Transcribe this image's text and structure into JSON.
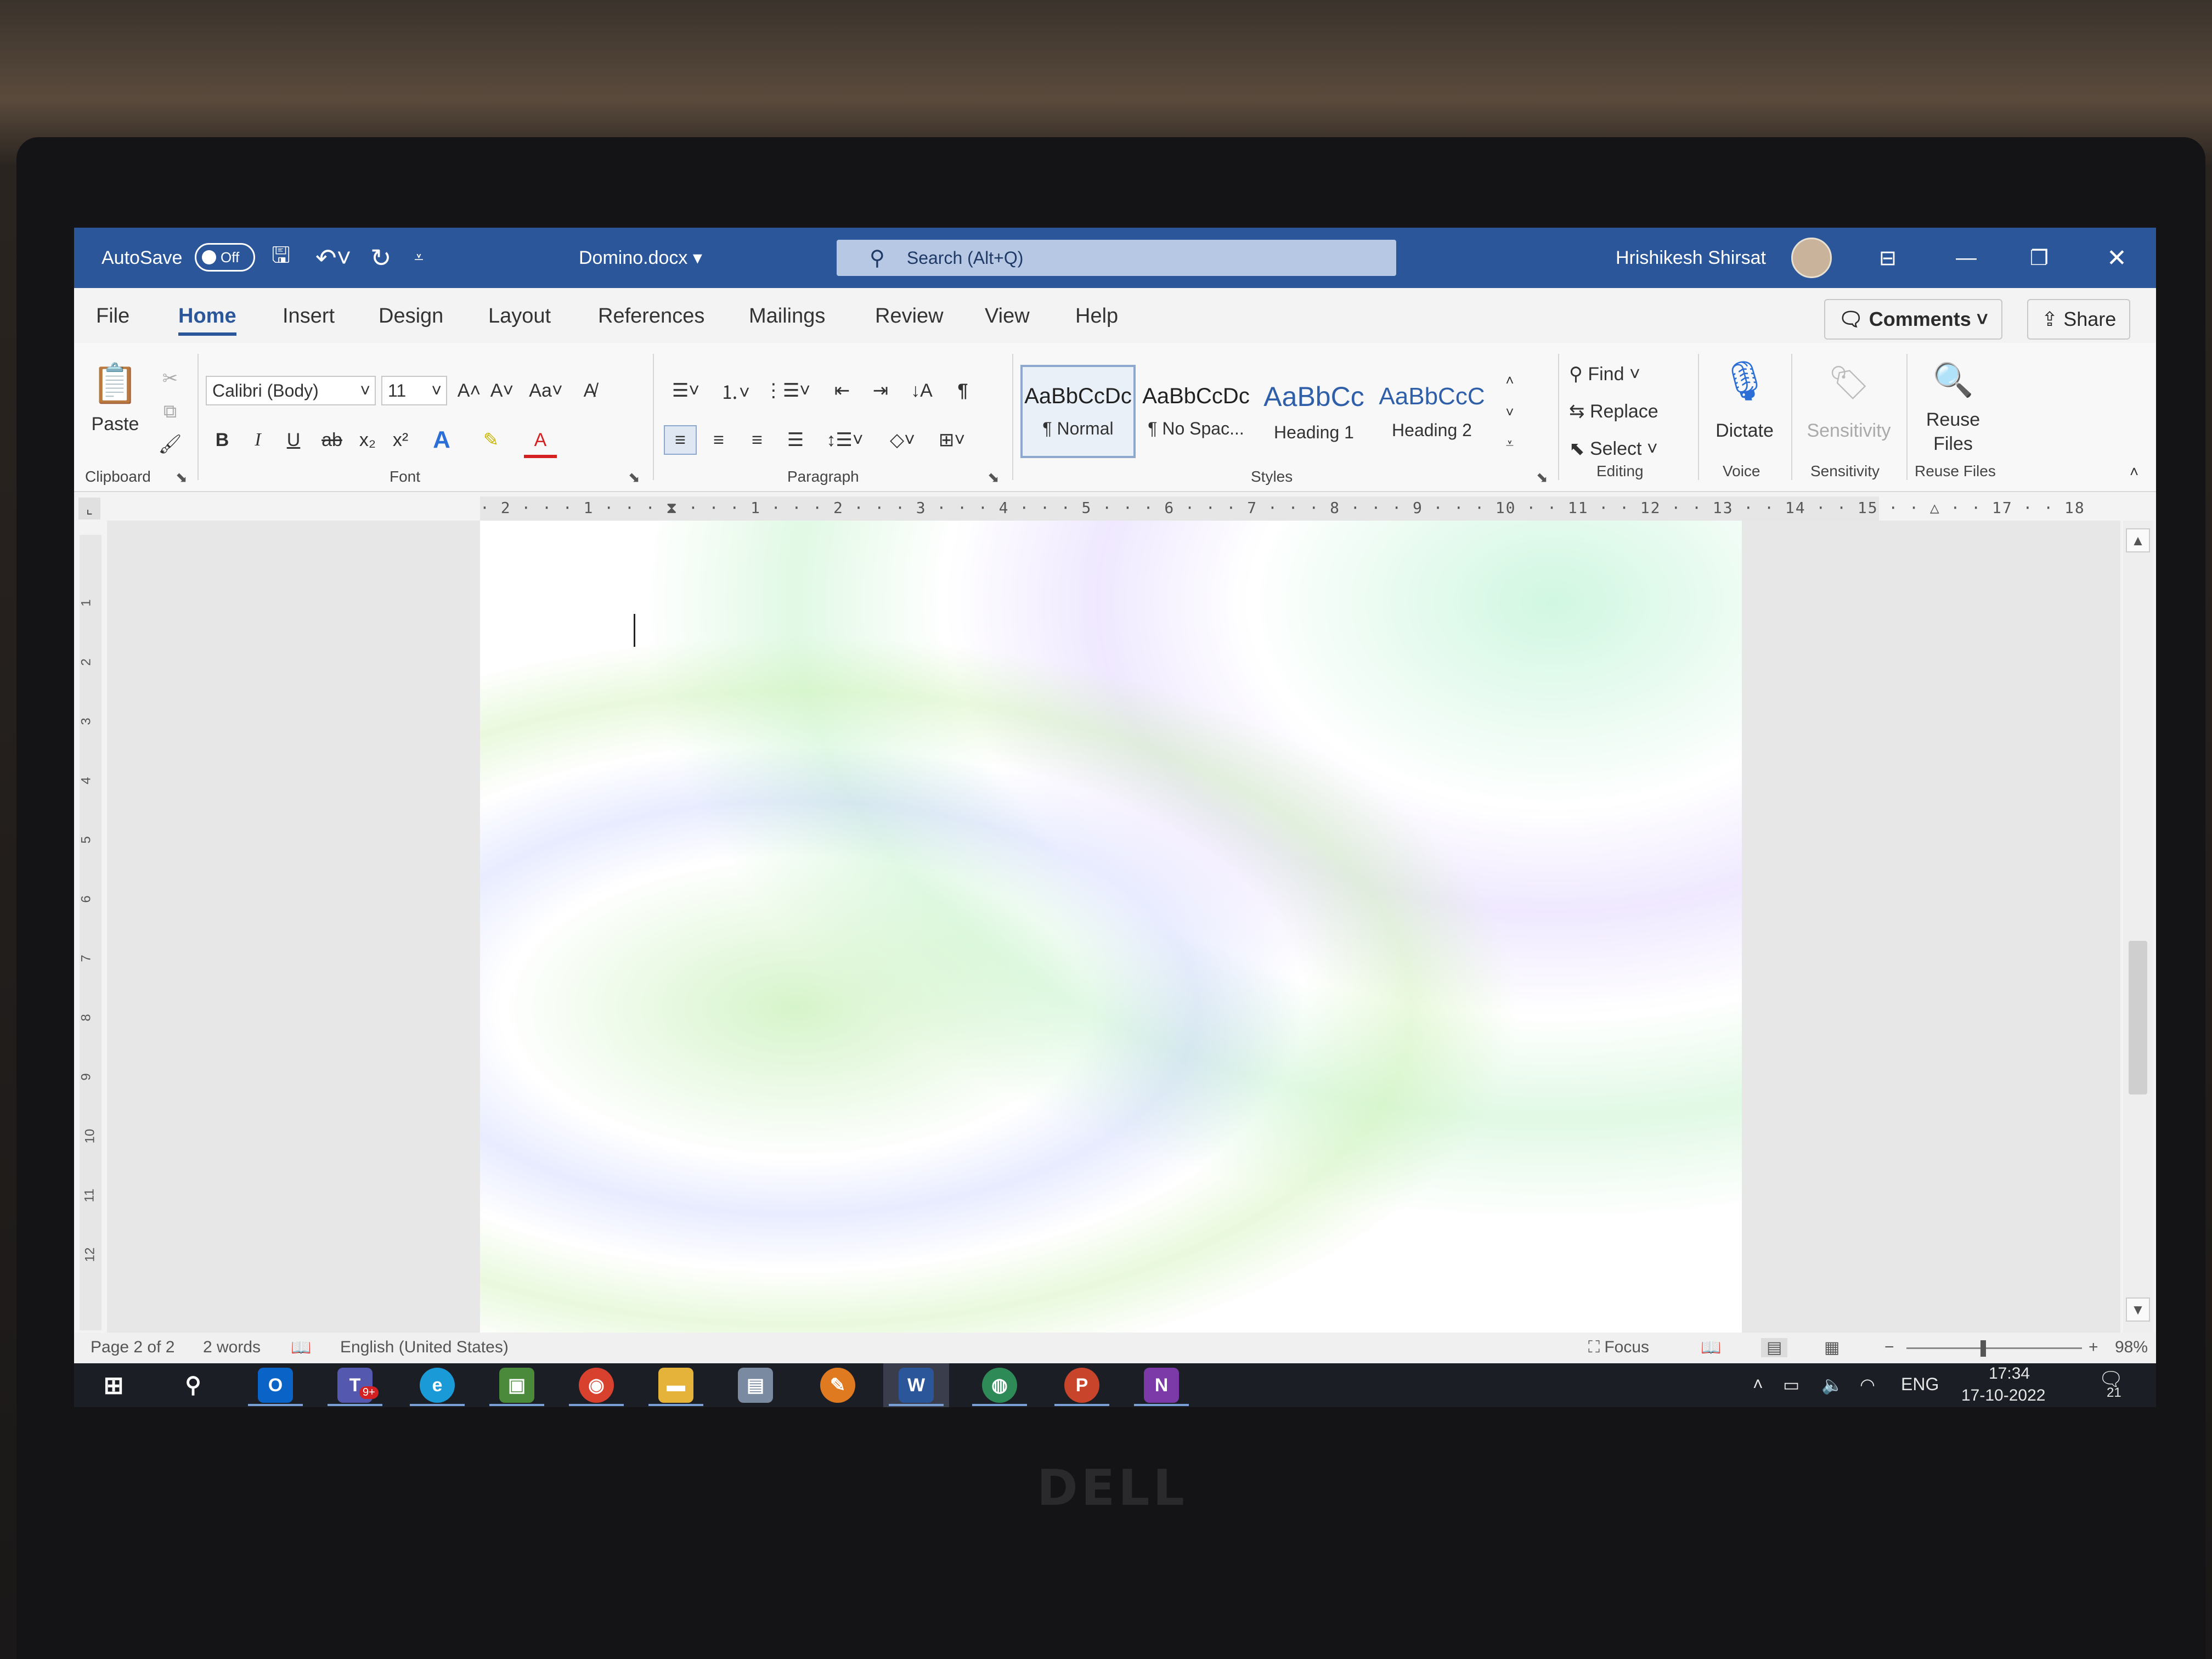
{
  "titlebar": {
    "autosave_label": "AutoSave",
    "autosave_state": "Off",
    "document_title": "Domino.docx",
    "search_placeholder": "Search (Alt+Q)",
    "user_name": "Hrishikesh Shirsat"
  },
  "tabs": [
    {
      "label": "File"
    },
    {
      "label": "Home",
      "active": true
    },
    {
      "label": "Insert"
    },
    {
      "label": "Design"
    },
    {
      "label": "Layout"
    },
    {
      "label": "References"
    },
    {
      "label": "Mailings"
    },
    {
      "label": "Review"
    },
    {
      "label": "View"
    },
    {
      "label": "Help"
    }
  ],
  "actions": {
    "comments_label": "Comments",
    "share_label": "Share"
  },
  "ribbon": {
    "clipboard": {
      "paste_label": "Paste",
      "group_label": "Clipboard"
    },
    "font": {
      "font_name": "Calibri (Body)",
      "font_size": "11",
      "change_case": "Aa",
      "group_label": "Font",
      "bold": "B",
      "italic": "I",
      "underline": "U",
      "strike": "ab",
      "subscript": "x₂",
      "superscript": "x²",
      "text_effects": "A",
      "font_color": "A"
    },
    "paragraph": {
      "group_label": "Paragraph"
    },
    "styles": {
      "group_label": "Styles",
      "items": [
        {
          "preview": "AaBbCcDc",
          "name": "¶ Normal",
          "selected": true
        },
        {
          "preview": "AaBbCcDc",
          "name": "¶ No Spac..."
        },
        {
          "preview": "AaBbCc",
          "name": "Heading 1"
        },
        {
          "preview": "AaBbCcC",
          "name": "Heading 2"
        }
      ]
    },
    "editing": {
      "group_label": "Editing",
      "find": "Find",
      "replace": "Replace",
      "select": "Select"
    },
    "voice": {
      "group_label": "Voice",
      "dictate": "Dictate"
    },
    "sensitivity": {
      "group_label": "Sensitivity",
      "button": "Sensitivity"
    },
    "reuse": {
      "group_label": "Reuse Files",
      "button_line1": "Reuse",
      "button_line2": "Files"
    }
  },
  "ruler": {
    "horizontal": "· 2 · · · 1 · · · ⧗ · · · 1 · · · 2 · · · 3 · · · 4 · · · 5 · · · 6 · · · 7 · · · 8 · · · 9 · · · 10 · · 11 · · 12 · · 13 · · 14 · · 15 · · △ · · 17 · · 18",
    "vertical": [
      "1",
      "2",
      "3",
      "4",
      "5",
      "6",
      "7",
      "8",
      "9",
      "10",
      "11",
      "12"
    ]
  },
  "statusbar": {
    "page": "Page 2 of 2",
    "words": "2 words",
    "language": "English (United States)",
    "focus": "Focus",
    "zoom_minus": "−",
    "zoom_plus": "+",
    "zoom": "98%"
  },
  "taskbar": {
    "apps": [
      {
        "name": "outlook",
        "glyph": "O",
        "color": "#0a64c8"
      },
      {
        "name": "teams",
        "glyph": "T",
        "color": "#5558af"
      },
      {
        "name": "edge",
        "glyph": "e",
        "color": "#1a9ad6"
      },
      {
        "name": "photos",
        "glyph": "▣",
        "color": "#4a8a3a"
      },
      {
        "name": "chrome",
        "glyph": "◉",
        "color": "#d9412f"
      },
      {
        "name": "explorer",
        "glyph": "▬",
        "color": "#e5b33a"
      },
      {
        "name": "notes",
        "glyph": "▤",
        "color": "#7a8aa0"
      },
      {
        "name": "sketch",
        "glyph": "✎",
        "color": "#e07a20"
      },
      {
        "name": "word",
        "glyph": "W",
        "color": "#2b579a",
        "active": true
      },
      {
        "name": "maps",
        "glyph": "◍",
        "color": "#2e8a56"
      },
      {
        "name": "powerpoint",
        "glyph": "P",
        "color": "#c8452b"
      },
      {
        "name": "onenote",
        "glyph": "N",
        "color": "#7b3aa8"
      }
    ],
    "tray_lang": "ENG",
    "time": "17:34",
    "date": "17-10-2022",
    "notification_count": "21",
    "teams_badge": "9+"
  }
}
